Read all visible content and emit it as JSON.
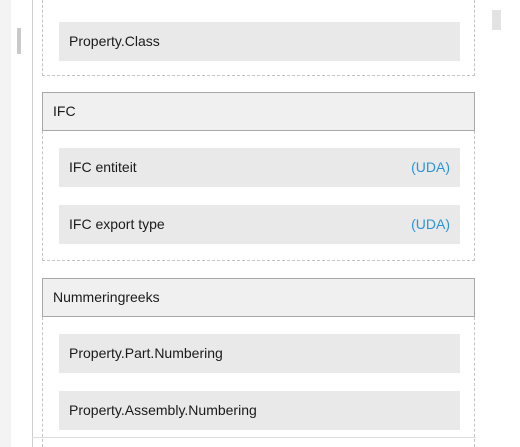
{
  "groups": [
    {
      "header": "",
      "items": [
        {
          "label": "Property.Class",
          "tag": ""
        }
      ]
    },
    {
      "header": "IFC",
      "items": [
        {
          "label": "IFC entiteit",
          "tag": "(UDA)"
        },
        {
          "label": "IFC export type",
          "tag": "(UDA)"
        }
      ]
    },
    {
      "header": "Nummeringreeks",
      "items": [
        {
          "label": "Property.Part.Numbering",
          "tag": ""
        },
        {
          "label": "Property.Assembly.Numbering",
          "tag": ""
        }
      ]
    }
  ],
  "colors": {
    "tag": "#2a94d6",
    "item_bg": "#e9e9e9",
    "header_bg": "#f0f0f0"
  }
}
